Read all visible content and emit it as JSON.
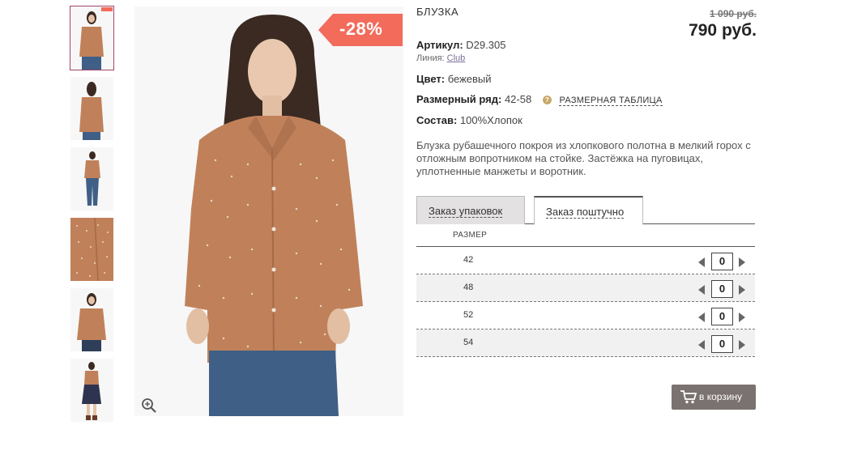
{
  "product": {
    "title": "БЛУЗКА",
    "old_price": "1 090 руб.",
    "price": "790 руб.",
    "discount": "-28%",
    "article_label": "Артикул:",
    "article_value": "D29.305",
    "line_label": "Линия:",
    "line_value": "Club",
    "color_label": "Цвет:",
    "color_value": "бежевый",
    "size_range_label": "Размерный ряд:",
    "size_range_value": "42-58",
    "size_table_link": "РАЗМЕРНАЯ ТАБЛИЦА",
    "composition_label": "Состав:",
    "composition_value": "100%Хлопок",
    "description": "Блузка рубашечного покроя из хлопкового полотна в мелкий горох с отложным вопротником на стойке. Застёжка на пуговицах, уплотненные манжеты и воротник."
  },
  "tabs": [
    {
      "label": "Заказ упаковок",
      "active": false
    },
    {
      "label": "Заказ поштучно",
      "active": true
    }
  ],
  "size_table": {
    "header": "РАЗМЕР",
    "rows": [
      {
        "size": "42",
        "qty": "0"
      },
      {
        "size": "48",
        "qty": "0"
      },
      {
        "size": "52",
        "qty": "0"
      },
      {
        "size": "54",
        "qty": "0"
      }
    ]
  },
  "cart_button": "в корзину",
  "icons": {
    "zoom": "zoom-in-icon",
    "cart": "cart-icon",
    "question": "question-icon",
    "decrement": "arrow-left-icon",
    "increment": "arrow-right-icon"
  },
  "colors": {
    "discount_badge": "#f26b5b",
    "shirt": "#c0815a",
    "cart_button": "#7a7270",
    "tab_inactive": "#e3e1e1",
    "link": "#7a6f98"
  }
}
